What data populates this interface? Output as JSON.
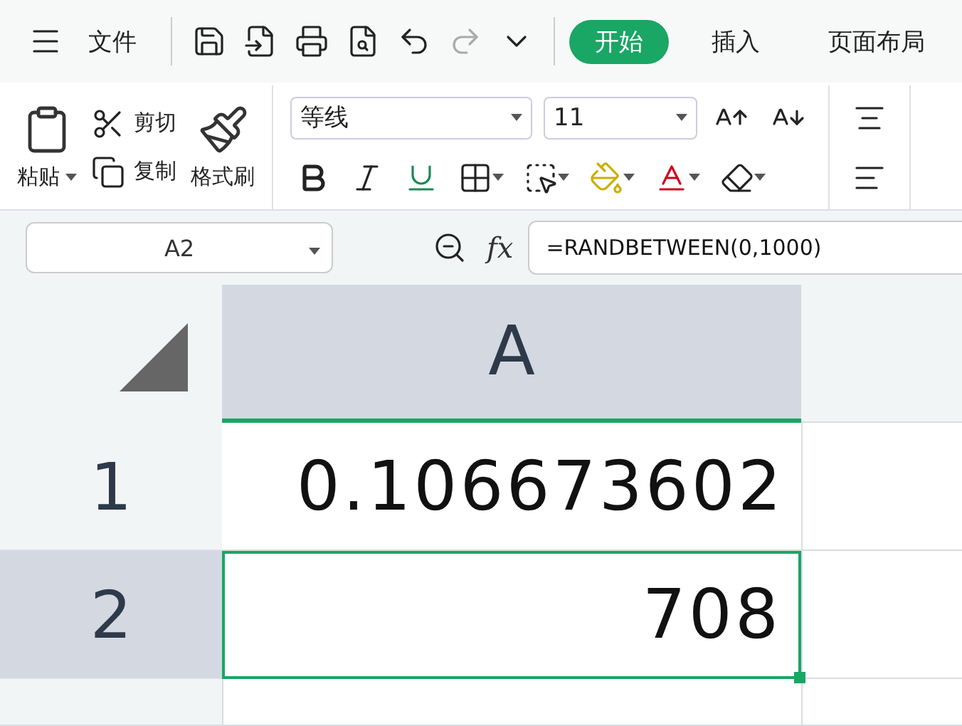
{
  "menu": {
    "label": "文件"
  },
  "quick_access": [
    {
      "kind": "save",
      "disabled": false
    },
    {
      "kind": "export",
      "disabled": false
    },
    {
      "kind": "print",
      "disabled": false
    },
    {
      "kind": "preview",
      "disabled": false
    },
    {
      "kind": "undo",
      "disabled": false
    },
    {
      "kind": "redo",
      "disabled": true
    },
    {
      "kind": "more",
      "disabled": false
    }
  ],
  "tabs": [
    {
      "label": "开始",
      "selected": true
    },
    {
      "label": "插入",
      "selected": false
    },
    {
      "label": "页面布局",
      "selected": false
    }
  ],
  "clipboard": {
    "paste": "粘贴",
    "cut": "剪切",
    "copy": "复制",
    "format_painter": "格式刷"
  },
  "font": {
    "name": "等线",
    "size": "11"
  },
  "name_box": "A2",
  "formula_label": "fx",
  "formula": "=RANDBETWEEN(0,1000)",
  "sheet": {
    "columns": [
      {
        "label": "A",
        "selected": true
      }
    ],
    "rows": [
      {
        "label": "1",
        "selected": false,
        "value": "0.106673602"
      },
      {
        "label": "2",
        "selected": true,
        "value": "708"
      }
    ]
  }
}
